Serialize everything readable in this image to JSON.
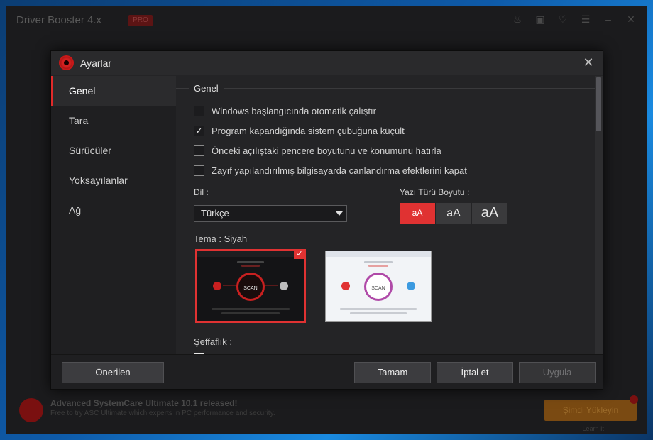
{
  "background_app": {
    "title": "Driver Booster 4.x",
    "badge": "PRO",
    "promo_title": "Advanced SystemCare Ultimate 10.1 released!",
    "promo_subtitle": "Free to try ASC Ultimate which experts in PC performance and security.",
    "promo_button": "Şimdi Yükleyin",
    "promo_small": "Learn It"
  },
  "dialog": {
    "title": "Ayarlar",
    "close_glyph": "✕"
  },
  "sidebar": {
    "items": [
      {
        "label": "Genel",
        "active": true
      },
      {
        "label": "Tara",
        "active": false
      },
      {
        "label": "Sürücüler",
        "active": false
      },
      {
        "label": "Yoksayılanlar",
        "active": false
      },
      {
        "label": "Ağ",
        "active": false
      }
    ]
  },
  "general": {
    "section_title": "Genel",
    "checkboxes": [
      {
        "label": "Windows başlangıcında otomatik çalıştır",
        "checked": false
      },
      {
        "label": "Program kapandığında sistem çubuğuna küçült",
        "checked": true
      },
      {
        "label": "Önceki açılıştaki pencere boyutunu ve konumunu hatırla",
        "checked": false
      },
      {
        "label": "Zayıf yapılandırılmış bilgisayarda canlandırma efektlerini kapat",
        "checked": false
      }
    ],
    "language_label": "Dil :",
    "language_value": "Türkçe",
    "font_size_label": "Yazı Türü Boyutu :",
    "font_sizes": [
      {
        "label": "aA",
        "active": true
      },
      {
        "label": "aA",
        "active": false
      },
      {
        "label": "aA",
        "active": false
      }
    ],
    "theme_label": "Tema : Siyah",
    "theme_scan_text": "SCAN",
    "theme_check_glyph": "✓",
    "opacity_label": "Şeffaflık :"
  },
  "footer": {
    "recommended": "Önerilen",
    "ok": "Tamam",
    "cancel": "İptal et",
    "apply": "Uygula"
  },
  "colors": {
    "accent": "#e03232",
    "panel": "#242426",
    "sidebar": "#1f1f21"
  }
}
